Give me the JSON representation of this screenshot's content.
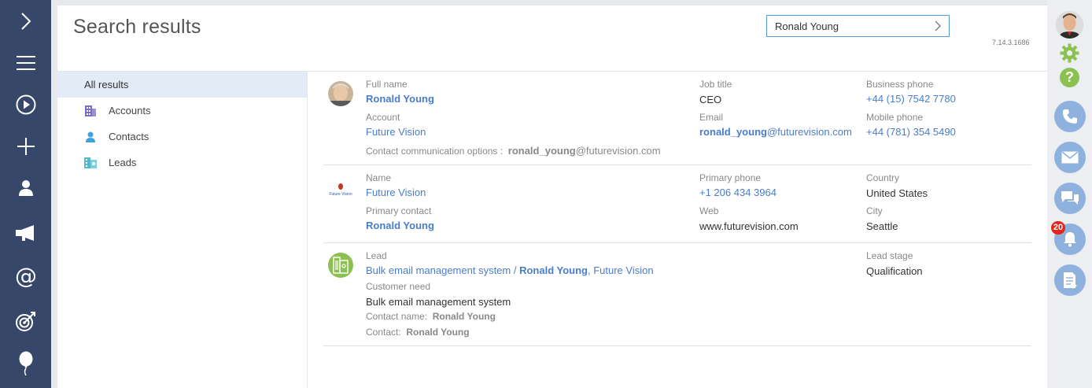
{
  "page": {
    "title": "Search results",
    "version": "7.14.3.1686"
  },
  "search": {
    "value": "Ronald Young"
  },
  "filters": [
    {
      "label": "All results"
    },
    {
      "label": "Accounts",
      "icon": "accounts-icon"
    },
    {
      "label": "Contacts",
      "icon": "contacts-icon"
    },
    {
      "label": "Leads",
      "icon": "leads-icon"
    }
  ],
  "results": {
    "contact": {
      "full_name_label": "Full name",
      "full_name": "Ronald Young",
      "account_label": "Account",
      "account": "Future Vision",
      "comm_label": "Contact communication options :",
      "comm_bold": "ronald_young",
      "comm_rest": "@futurevision.com",
      "job_title_label": "Job title",
      "job_title": "CEO",
      "email_label": "Email",
      "email_bold": "ronald_young",
      "email_rest": "@futurevision.com",
      "business_phone_label": "Business phone",
      "business_phone": "+44 (15) 7542 7780",
      "mobile_phone_label": "Mobile phone",
      "mobile_phone": "+44 (781) 354 5490"
    },
    "account": {
      "logo_text": "Future Vision",
      "name_label": "Name",
      "name": "Future Vision",
      "primary_contact_label": "Primary contact",
      "primary_contact": "Ronald Young",
      "primary_phone_label": "Primary phone",
      "primary_phone": "+1 206 434 3964",
      "web_label": "Web",
      "web": "www.futurevision.com",
      "country_label": "Country",
      "country": "United States",
      "city_label": "City",
      "city": "Seattle"
    },
    "lead": {
      "lead_label": "Lead",
      "lead_part1": "Bulk email management system / ",
      "lead_part2": "Ronald Young",
      "lead_part3": ", Future Vision",
      "customer_need_label": "Customer need",
      "customer_need": "Bulk email management system",
      "contact_name_label": "Contact name:",
      "contact_name": "Ronald Young",
      "contact_label": "Contact:",
      "contact": "Ronald Young",
      "stage_label": "Lead stage",
      "stage": "Qualification"
    }
  },
  "rightbar": {
    "notifications_count": "20"
  },
  "colors": {
    "nav_bg": "#37476a",
    "link": "#4a7dc9",
    "accent_green": "#8cc152",
    "circle_blue": "#8fb1dd",
    "badge_red": "#e2261c"
  }
}
